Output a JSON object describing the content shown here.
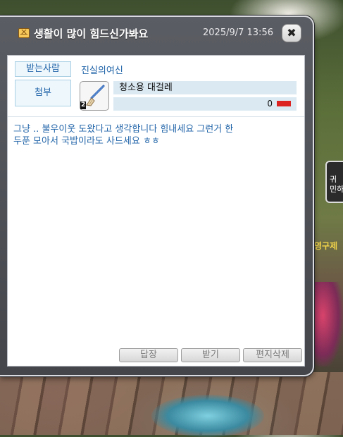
{
  "window": {
    "title": "생활이 많이 힘드신가봐요",
    "date": "2025/9/7 13:56",
    "close_icon": "close-icon"
  },
  "recipient": {
    "label": "받는사람",
    "name": "진실의여신"
  },
  "attachment": {
    "label": "첨부",
    "item_icon": "broom-icon",
    "item_quantity": "2",
    "item_name": "청소용 대걸레",
    "meso_amount": "0",
    "meso_unit_icon": "meso-icon"
  },
  "message": {
    "body": "그냥 .. 불우이웃 도왔다고 생각합니다 힘내세요 그런거 한\n두푼 모아서 국밥이라도 사드세요 ㅎㅎ"
  },
  "buttons": {
    "reply": "답장",
    "receive": "받기",
    "delete": "편지삭제"
  },
  "background": {
    "npc_tab_text": "귀\n민하",
    "npc_label_text": "영구제"
  }
}
